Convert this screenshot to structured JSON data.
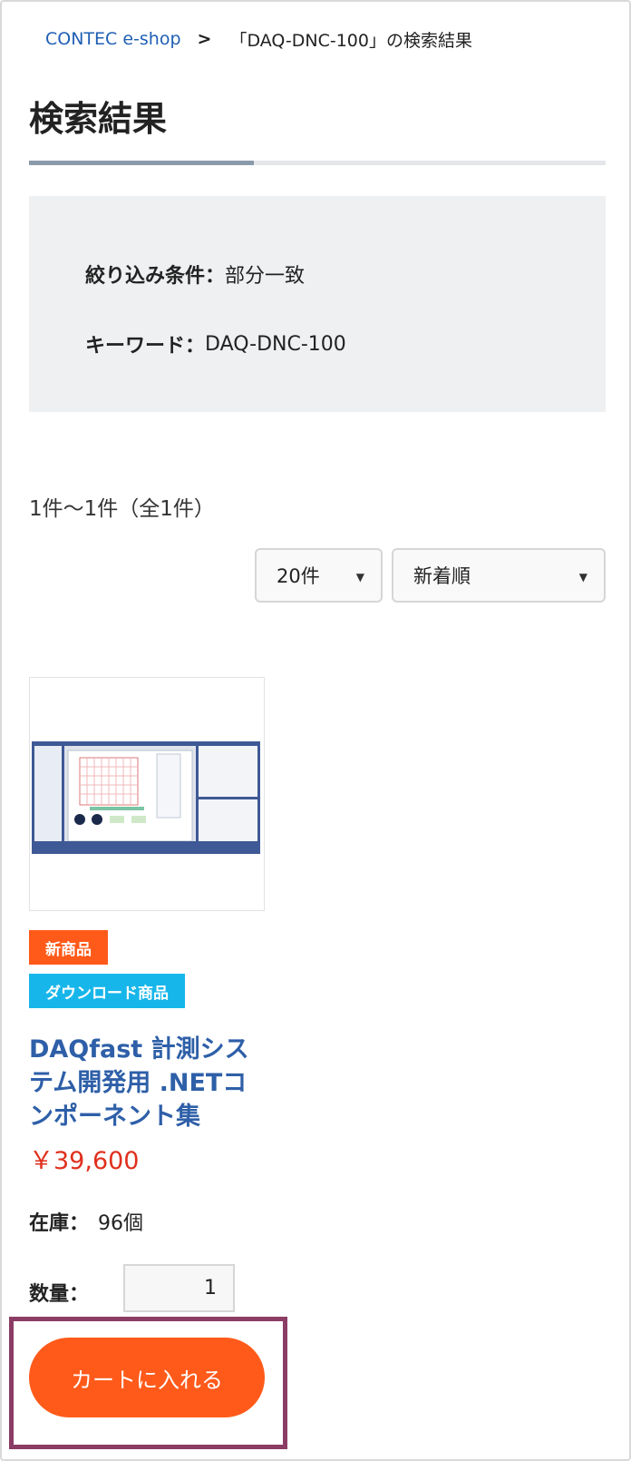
{
  "breadcrumb": {
    "home": "CONTEC e-shop",
    "separator": ">",
    "current": "「DAQ-DNC-100」の検索結果"
  },
  "page_title": "検索結果",
  "filter": {
    "condition_label": "絞り込み条件：",
    "condition_value": "部分一致",
    "keyword_label": "キーワード：",
    "keyword_value": "DAQ-DNC-100"
  },
  "results": {
    "count_text": "1件〜1件（全1件）",
    "per_page": "20件",
    "sort": "新着順"
  },
  "product": {
    "badges": {
      "new": "新商品",
      "download": "ダウンロード商品"
    },
    "name": "DAQfast 計測システム開発用 .NETコンポーネント集",
    "price": "￥39,600",
    "stock_label": "在庫：",
    "stock_value": "96個",
    "quantity_label": "数量：",
    "quantity_value": "1",
    "cart_button": "カートに入れる"
  },
  "colors": {
    "accent_orange": "#ff5a1a",
    "badge_blue": "#17b6ea",
    "link_blue": "#1f5fb4",
    "price_red": "#e0301e",
    "highlight": "#8b3d65"
  }
}
